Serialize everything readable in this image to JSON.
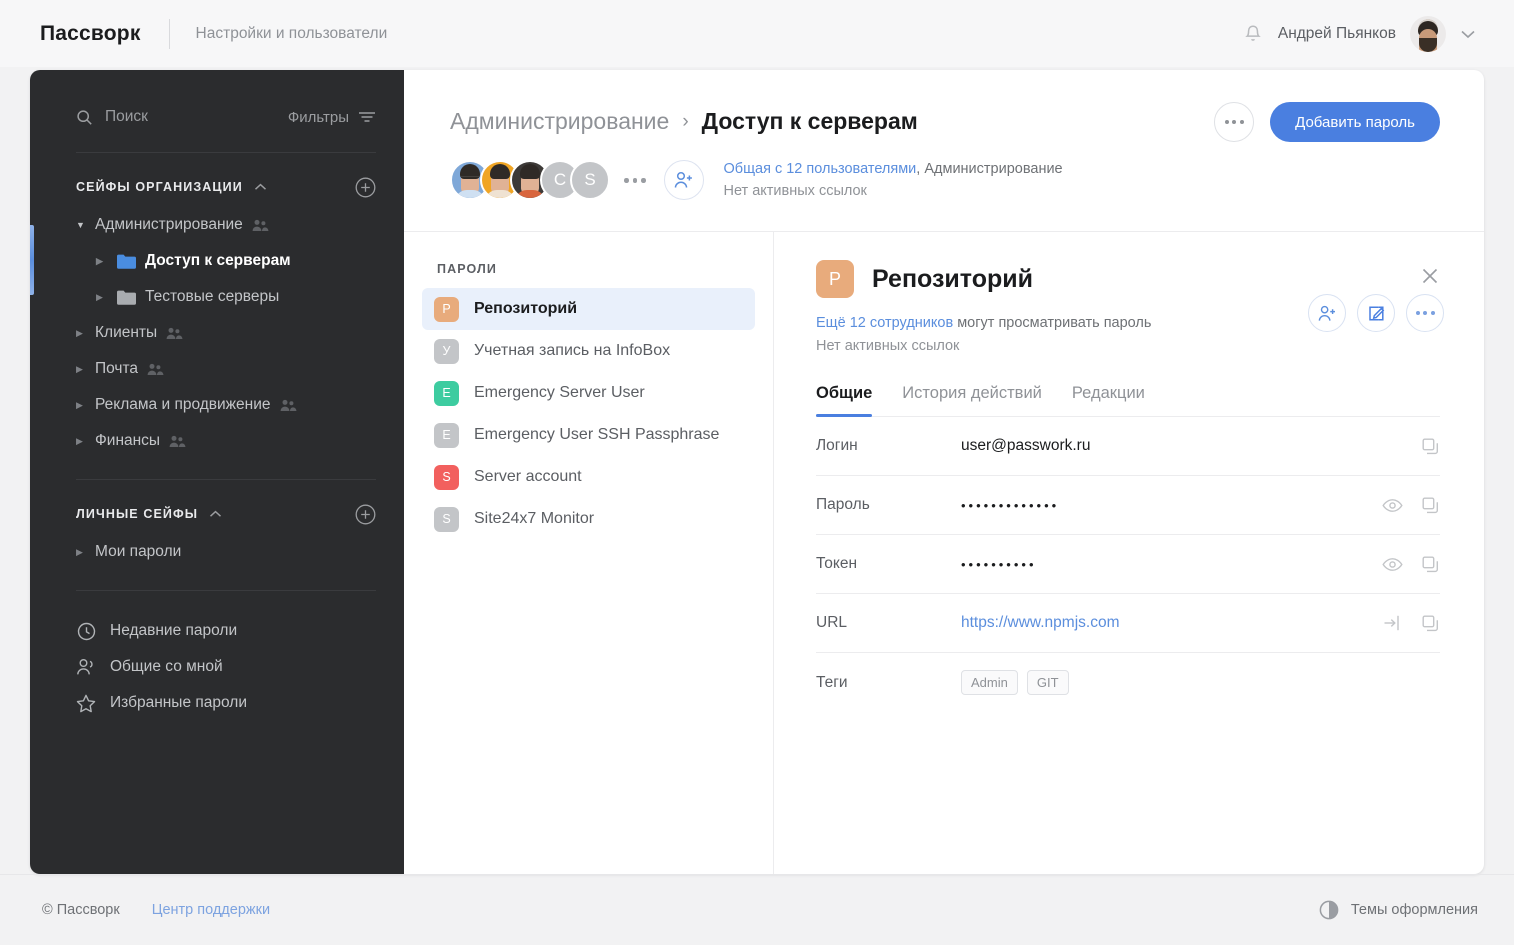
{
  "topbar": {
    "brand": "Пассворк",
    "section": "Настройки и пользователи",
    "bell_icon": "bell-icon",
    "user_name": "Андрей Пьянков",
    "chevron": "⌄"
  },
  "sidebar": {
    "search_placeholder": "Поиск",
    "filters_label": "Фильтры",
    "org_section": {
      "title": "СЕЙФЫ ОРГАНИЗАЦИИ"
    },
    "tree": [
      {
        "label": "Администрирование",
        "level": 1,
        "open": true,
        "shared": true,
        "selected": false
      },
      {
        "label": "Доступ к серверам",
        "level": 2,
        "open": false,
        "folder": "blue",
        "selected": true
      },
      {
        "label": "Тестовые серверы",
        "level": 2,
        "open": false,
        "folder": "gray",
        "selected": false
      },
      {
        "label": "Клиенты",
        "level": 1,
        "open": false,
        "shared": true,
        "selected": false
      },
      {
        "label": "Почта",
        "level": 1,
        "open": false,
        "shared": true,
        "selected": false
      },
      {
        "label": "Реклама и продвижение",
        "level": 1,
        "open": false,
        "shared": true,
        "selected": false
      },
      {
        "label": "Финансы",
        "level": 1,
        "open": false,
        "shared": true,
        "selected": false
      }
    ],
    "personal_section": {
      "title": "ЛИЧНЫЕ СЕЙФЫ"
    },
    "personal_tree": [
      {
        "label": "Мои пароли",
        "level": 1,
        "open": false,
        "selected": false
      }
    ],
    "quick_links": [
      {
        "label": "Недавние пароли",
        "icon": "clock-icon"
      },
      {
        "label": "Общие со мной",
        "icon": "people-icon"
      },
      {
        "label": "Избранные пароли",
        "icon": "star-icon"
      }
    ]
  },
  "header": {
    "breadcrumb_parent": "Администрирование",
    "breadcrumb_sep": "›",
    "breadcrumb_current": "Доступ к серверам",
    "more_button": "more-icon",
    "add_password_label": "Добавить пароль",
    "avatar_letters": [
      "C",
      "S"
    ],
    "share_link_text": "Общая с 12 пользователями",
    "share_rest_text": ", Администрирование",
    "share_line2": "Нет активных ссылок"
  },
  "passwords": {
    "heading": "ПАРОЛИ",
    "items": [
      {
        "name": "Репозиторий",
        "letter": "P",
        "color": "#e8ab7c",
        "active": true
      },
      {
        "name": "Учетная запись на InfoBox",
        "letter": "У",
        "color": "#c3c5c8",
        "active": false
      },
      {
        "name": "Emergency Server User",
        "letter": "E",
        "color": "#3dcca0",
        "active": false
      },
      {
        "name": "Emergency User SSH Passphrase",
        "letter": "E",
        "color": "#c3c5c8",
        "active": false
      },
      {
        "name": "Server account",
        "letter": "S",
        "color": "#f2605e",
        "active": false
      },
      {
        "name": "Site24x7 Monitor",
        "letter": "S",
        "color": "#c3c5c8",
        "active": false
      }
    ]
  },
  "detail": {
    "badge_letter": "P",
    "badge_color": "#e8ab7c",
    "title": "Репозиторий",
    "sub_link": "Ещё 12 сотрудников",
    "sub_rest": " могут просматривать пароль",
    "sub_line2": "Нет активных ссылок",
    "actions": [
      "add-user-icon",
      "edit-icon",
      "more-icon"
    ],
    "tabs": [
      {
        "label": "Общие",
        "active": true
      },
      {
        "label": "История действий",
        "active": false
      },
      {
        "label": "Редакции",
        "active": false
      }
    ],
    "fields": [
      {
        "label": "Логин",
        "value": "user@passwork.ru",
        "type": "text",
        "icons": [
          "copy-icon"
        ]
      },
      {
        "label": "Пароль",
        "value": "•••••••••••••",
        "type": "masked",
        "icons": [
          "eye-icon",
          "copy-icon"
        ]
      },
      {
        "label": "Токен",
        "value": "••••••••••",
        "type": "masked",
        "icons": [
          "eye-icon",
          "copy-icon"
        ]
      },
      {
        "label": "URL",
        "value": "https://www.npmjs.com",
        "type": "link",
        "icons": [
          "open-link-icon",
          "copy-icon"
        ]
      }
    ],
    "tags_label": "Теги",
    "tags": [
      "Admin",
      "GIT"
    ]
  },
  "footer": {
    "copyright": "© Пассворк",
    "support_link": "Центр поддержки",
    "theme_label": "Темы оформления",
    "theme_icon": "half-circle-icon"
  },
  "colors": {
    "accent": "#4a7fe0",
    "sidebar_bg": "#2b2c2e",
    "link": "#5b8edd",
    "selected_row": "#e9f0fb"
  }
}
